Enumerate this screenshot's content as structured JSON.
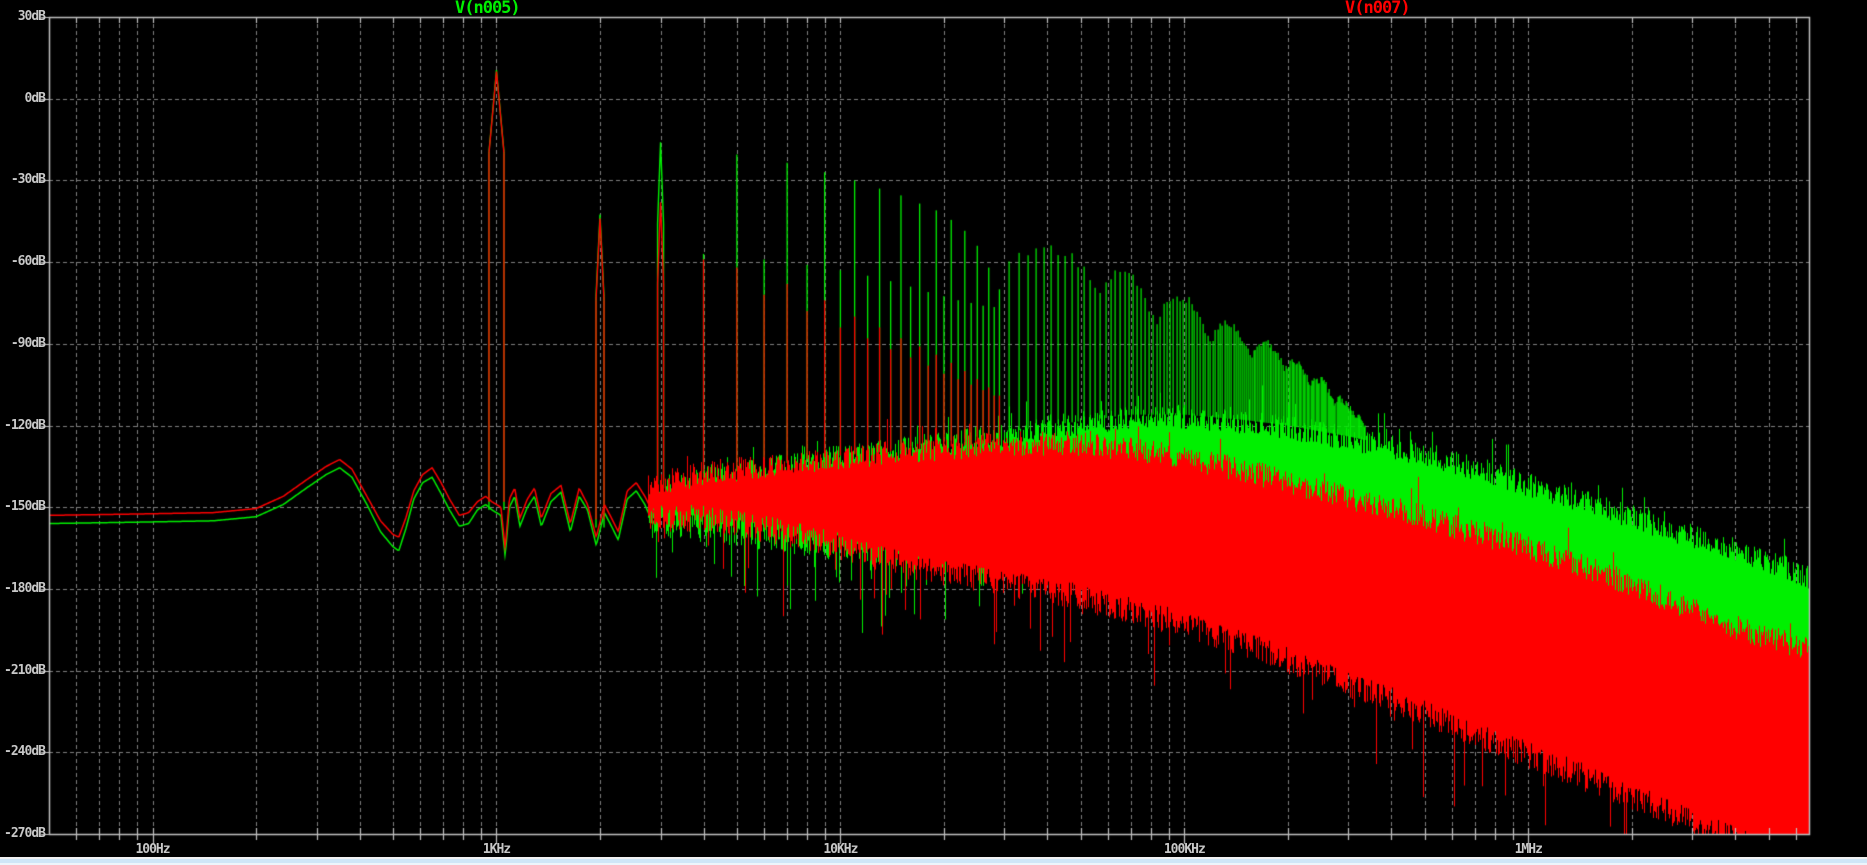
{
  "legend": [
    {
      "label": "V(n005)",
      "color": "#00F000"
    },
    {
      "label": "V(n007)",
      "color": "#FF0000"
    }
  ],
  "chart_data": {
    "type": "line",
    "title": "",
    "background": "#000000",
    "frame_color": "#C0C0C0",
    "grid": {
      "color": "#7F7F7F",
      "style": "dashed",
      "on": true
    },
    "x_axis": {
      "scale": "log",
      "unit": "Hz",
      "min_hz": 50,
      "max_hz": 6550000,
      "ticks": [
        {
          "label": "100Hz",
          "hz": 100
        },
        {
          "label": "1KHz",
          "hz": 1000
        },
        {
          "label": "10KHz",
          "hz": 10000
        },
        {
          "label": "100KHz",
          "hz": 100000
        },
        {
          "label": "1MHz",
          "hz": 1000000
        }
      ]
    },
    "y_axis": {
      "unit": "dB",
      "min_db": -270,
      "max_db": 30,
      "step_db": 30,
      "ticks": [
        {
          "label": "30dB",
          "db": 30
        },
        {
          "label": "0dB",
          "db": 0
        },
        {
          "label": "-30dB",
          "db": -30
        },
        {
          "label": "-60dB",
          "db": -60
        },
        {
          "label": "-90dB",
          "db": -90
        },
        {
          "label": "-120dB",
          "db": -120
        },
        {
          "label": "-150dB",
          "db": -150
        },
        {
          "label": "-180dB",
          "db": -180
        },
        {
          "label": "-210dB",
          "db": -210
        },
        {
          "label": "-240dB",
          "db": -240
        },
        {
          "label": "-270dB",
          "db": -270
        }
      ]
    },
    "series": [
      {
        "name": "V(n005)",
        "color": "#00F000",
        "baseline_db": [
          [
            50,
            -156
          ],
          [
            90,
            -155.5
          ],
          [
            150,
            -155
          ],
          [
            200,
            -153.5
          ],
          [
            240,
            -149
          ],
          [
            280,
            -143
          ],
          [
            320,
            -138
          ],
          [
            350,
            -135.5
          ],
          [
            380,
            -139
          ],
          [
            420,
            -149
          ],
          [
            460,
            -159
          ],
          [
            500,
            -164.5
          ],
          [
            520,
            -166
          ],
          [
            545,
            -158
          ],
          [
            575,
            -147
          ],
          [
            610,
            -141
          ],
          [
            650,
            -139
          ],
          [
            690,
            -145
          ],
          [
            730,
            -151
          ],
          [
            780,
            -157
          ],
          [
            830,
            -156
          ],
          [
            880,
            -151
          ],
          [
            930,
            -149
          ],
          [
            970,
            -151
          ],
          [
            1030,
            -153
          ],
          [
            1060,
            -168
          ],
          [
            1090,
            -150
          ],
          [
            1130,
            -146
          ],
          [
            1170,
            -157
          ],
          [
            1230,
            -150
          ],
          [
            1290,
            -146
          ],
          [
            1350,
            -157
          ],
          [
            1440,
            -148
          ],
          [
            1540,
            -144.5
          ],
          [
            1640,
            -159
          ],
          [
            1740,
            -146
          ],
          [
            1840,
            -151
          ],
          [
            1950,
            -164
          ],
          [
            2060,
            -152
          ],
          [
            2160,
            -157
          ],
          [
            2260,
            -162
          ],
          [
            2400,
            -147
          ],
          [
            2550,
            -144
          ],
          [
            2700,
            -149
          ],
          [
            2850,
            -156
          ],
          [
            3000,
            -150
          ]
        ],
        "harmonic_peaks_db": [
          [
            1000,
            10.5
          ],
          [
            2000,
            -42.5
          ],
          [
            3000,
            -16
          ],
          [
            4000,
            -57
          ],
          [
            5000,
            -20.5
          ],
          [
            6000,
            -59
          ],
          [
            7000,
            -23.5
          ],
          [
            8000,
            -61
          ],
          [
            9000,
            -27
          ],
          [
            10000,
            -63
          ],
          [
            11000,
            -30
          ],
          [
            12000,
            -65
          ],
          [
            13000,
            -33
          ],
          [
            14000,
            -67
          ],
          [
            15000,
            -35.5
          ],
          [
            16000,
            -69
          ],
          [
            17000,
            -38.5
          ],
          [
            18000,
            -71
          ],
          [
            19000,
            -41
          ],
          [
            20000,
            -72.5
          ],
          [
            21000,
            -44.5
          ],
          [
            22000,
            -74
          ],
          [
            23000,
            -48.5
          ],
          [
            24000,
            -75
          ],
          [
            25000,
            -54
          ],
          [
            26000,
            -76
          ],
          [
            27000,
            -62
          ],
          [
            28000,
            -76.5
          ],
          [
            29000,
            -70
          ]
        ],
        "carrier_lobe_envelope_db": [
          [
            31000,
            -60
          ],
          [
            35000,
            -56
          ],
          [
            40000,
            -55
          ],
          [
            46000,
            -57
          ],
          [
            52000,
            -64
          ],
          [
            56000,
            -73
          ],
          [
            60000,
            -66
          ],
          [
            65000,
            -63
          ],
          [
            69000,
            -63
          ],
          [
            75000,
            -70
          ],
          [
            80000,
            -79
          ],
          [
            83000,
            -83
          ],
          [
            87000,
            -76
          ],
          [
            95000,
            -73
          ],
          [
            103000,
            -74
          ],
          [
            110000,
            -80
          ],
          [
            117000,
            -88
          ],
          [
            120000,
            -90
          ],
          [
            125000,
            -84
          ],
          [
            132000,
            -82
          ],
          [
            138000,
            -83
          ],
          [
            146000,
            -87
          ],
          [
            153000,
            -92
          ],
          [
            157000,
            -95
          ],
          [
            163000,
            -91
          ],
          [
            170000,
            -89
          ],
          [
            177000,
            -90
          ],
          [
            185000,
            -93
          ],
          [
            192000,
            -97
          ],
          [
            196000,
            -99
          ],
          [
            203000,
            -97
          ],
          [
            210000,
            -96
          ],
          [
            218000,
            -98
          ],
          [
            226000,
            -102
          ],
          [
            232000,
            -105
          ],
          [
            240000,
            -104
          ],
          [
            250000,
            -103
          ],
          [
            258000,
            -105
          ],
          [
            266000,
            -109
          ],
          [
            272000,
            -112
          ],
          [
            280000,
            -110
          ],
          [
            290000,
            -111
          ],
          [
            300000,
            -114
          ],
          [
            310000,
            -115
          ],
          [
            320000,
            -117
          ],
          [
            335000,
            -120
          ]
        ],
        "lobe_spike_spacing_hz": 2000,
        "noise_top_db": [
          [
            2800,
            -146
          ],
          [
            4000,
            -141
          ],
          [
            6000,
            -137
          ],
          [
            10000,
            -133
          ],
          [
            20000,
            -128
          ],
          [
            40000,
            -122
          ],
          [
            70000,
            -118
          ],
          [
            100000,
            -118
          ],
          [
            150000,
            -120
          ],
          [
            200000,
            -122
          ],
          [
            300000,
            -126
          ],
          [
            500000,
            -132
          ],
          [
            700000,
            -137
          ],
          [
            1000000,
            -143
          ],
          [
            1500000,
            -150
          ],
          [
            2000000,
            -155
          ],
          [
            3000000,
            -162
          ],
          [
            4500000,
            -169
          ],
          [
            6550000,
            -177
          ]
        ],
        "noise_thickness_db": [
          [
            2800,
            6
          ],
          [
            4000,
            12
          ],
          [
            8000,
            24
          ],
          [
            15000,
            32
          ],
          [
            30000,
            38
          ],
          [
            100000,
            40
          ],
          [
            1000000,
            40
          ],
          [
            6550000,
            42
          ]
        ]
      },
      {
        "name": "V(n007)",
        "color": "#FF0000",
        "baseline_db": [
          [
            50,
            -153
          ],
          [
            90,
            -152.5
          ],
          [
            150,
            -152
          ],
          [
            200,
            -150.5
          ],
          [
            240,
            -146
          ],
          [
            280,
            -140
          ],
          [
            320,
            -135
          ],
          [
            350,
            -132.5
          ],
          [
            380,
            -136
          ],
          [
            420,
            -146
          ],
          [
            460,
            -155
          ],
          [
            500,
            -160
          ],
          [
            520,
            -161
          ],
          [
            545,
            -154
          ],
          [
            575,
            -144
          ],
          [
            610,
            -138
          ],
          [
            650,
            -135.5
          ],
          [
            690,
            -141
          ],
          [
            730,
            -147
          ],
          [
            780,
            -153
          ],
          [
            830,
            -152
          ],
          [
            880,
            -148
          ],
          [
            930,
            -146
          ],
          [
            970,
            -148
          ],
          [
            1030,
            -150
          ],
          [
            1060,
            -165
          ],
          [
            1090,
            -147
          ],
          [
            1130,
            -143
          ],
          [
            1170,
            -154
          ],
          [
            1230,
            -147
          ],
          [
            1290,
            -143
          ],
          [
            1350,
            -154
          ],
          [
            1440,
            -145
          ],
          [
            1540,
            -142
          ],
          [
            1640,
            -156
          ],
          [
            1740,
            -143
          ],
          [
            1840,
            -149
          ],
          [
            1950,
            -161
          ],
          [
            2060,
            -149
          ],
          [
            2160,
            -154
          ],
          [
            2260,
            -159
          ],
          [
            2400,
            -144
          ],
          [
            2550,
            -141
          ],
          [
            2700,
            -146
          ],
          [
            2850,
            -152
          ],
          [
            3000,
            -147
          ]
        ],
        "harmonic_peaks_db": [
          [
            1000,
            10
          ],
          [
            2000,
            -44
          ],
          [
            3000,
            -38
          ],
          [
            4000,
            -59
          ],
          [
            5000,
            -62
          ],
          [
            6000,
            -72
          ],
          [
            7000,
            -68
          ],
          [
            8000,
            -78
          ],
          [
            9000,
            -74
          ],
          [
            10000,
            -84
          ],
          [
            11000,
            -80
          ],
          [
            12000,
            -88
          ],
          [
            13000,
            -84
          ],
          [
            14000,
            -92
          ],
          [
            15000,
            -88
          ],
          [
            16000,
            -95
          ],
          [
            17000,
            -91
          ],
          [
            18000,
            -98
          ],
          [
            19000,
            -94
          ],
          [
            20000,
            -101
          ],
          [
            21000,
            -97
          ],
          [
            22000,
            -103
          ],
          [
            23000,
            -100
          ],
          [
            24000,
            -105
          ],
          [
            25000,
            -103
          ],
          [
            26000,
            -107
          ],
          [
            27000,
            -106
          ],
          [
            28000,
            -109
          ],
          [
            29000,
            -109
          ]
        ],
        "carrier_lobe_envelope_db": [],
        "lobe_spike_spacing_hz": 0,
        "noise_top_db": [
          [
            2800,
            -143
          ],
          [
            4000,
            -139
          ],
          [
            6000,
            -136
          ],
          [
            10000,
            -133
          ],
          [
            20000,
            -130
          ],
          [
            30000,
            -128
          ],
          [
            50000,
            -128
          ],
          [
            70000,
            -130
          ],
          [
            100000,
            -133
          ],
          [
            150000,
            -138
          ],
          [
            200000,
            -142
          ],
          [
            300000,
            -148
          ],
          [
            500000,
            -155
          ],
          [
            700000,
            -161
          ],
          [
            1000000,
            -166
          ],
          [
            1500000,
            -174
          ],
          [
            2000000,
            -180
          ],
          [
            3000000,
            -189
          ],
          [
            4500000,
            -198
          ],
          [
            6550000,
            -203
          ]
        ],
        "noise_thickness_db": [
          [
            2800,
            6
          ],
          [
            4000,
            10
          ],
          [
            8000,
            22
          ],
          [
            15000,
            35
          ],
          [
            30000,
            45
          ],
          [
            60000,
            52
          ],
          [
            100000,
            55
          ],
          [
            300000,
            62
          ],
          [
            1000000,
            70
          ],
          [
            3000000,
            72
          ],
          [
            6550000,
            72
          ]
        ]
      }
    ]
  },
  "bottom_strip": {
    "colors": [
      "#F2F2F2",
      "#CFE6F7",
      "#EDF5FB"
    ]
  }
}
